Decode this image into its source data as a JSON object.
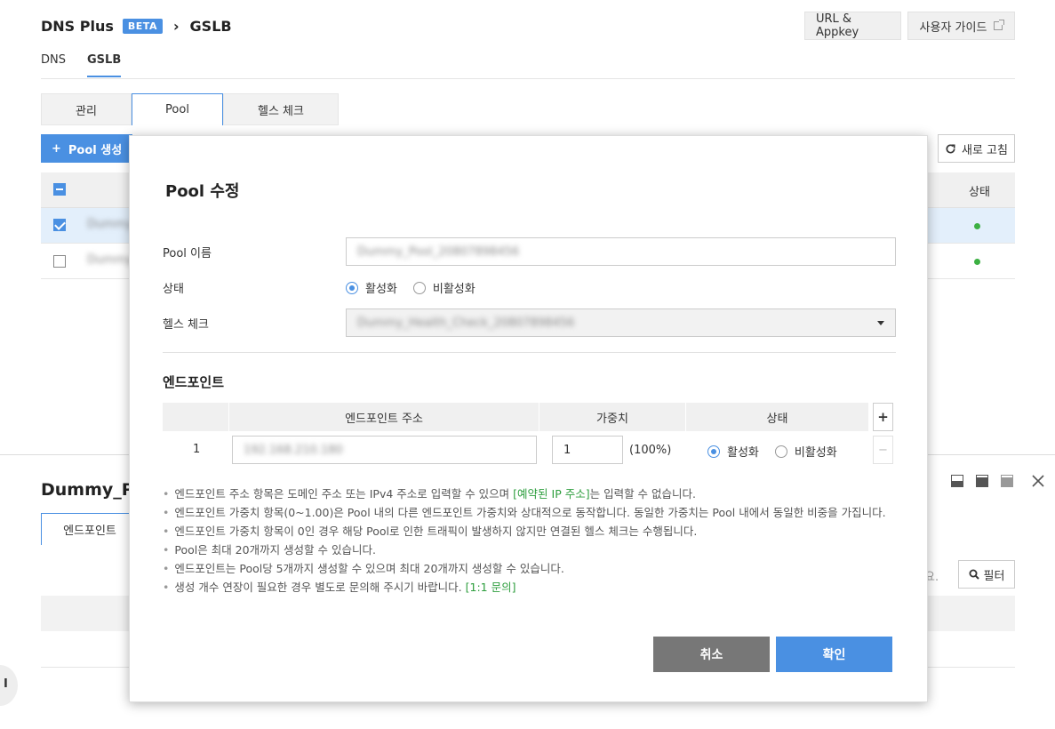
{
  "header": {
    "app_name": "DNS Plus",
    "beta_badge": "BETA",
    "crumb_sep": "›",
    "crumb_current": "GSLB",
    "url_appkey_label": "URL & Appkey",
    "user_guide_label": "사용자 가이드"
  },
  "service_tabs": [
    "DNS",
    "GSLB"
  ],
  "main_tabs": [
    "관리",
    "Pool",
    "헬스 체크"
  ],
  "toolbar": {
    "create_label": "Pool 생성",
    "create_plus": "+",
    "refresh_label": "새로 고침"
  },
  "grid": {
    "status_header": "상태",
    "rows": [
      {
        "name": "Dummy/",
        "checked": true
      },
      {
        "name": "Dummy/",
        "checked": false
      }
    ]
  },
  "detail": {
    "title": "Dummy_Po",
    "tab_endpoint": "엔드포인트",
    "filter_placeholder": "요.",
    "filter_label": "필터",
    "side_glyph": "I"
  },
  "modal": {
    "title": "Pool 수정",
    "pool_name_label": "Pool 이름",
    "pool_name_value": "Dummy_Pool_20807898456",
    "status_label": "상태",
    "status_active": "활성화",
    "status_inactive": "비활성화",
    "health_label": "헬스 체크",
    "health_value": "Dummy_Health_Check_20807898456",
    "endpoint_section": "엔드포인트",
    "ep_col_address": "엔드포인트 주소",
    "ep_col_weight": "가중치",
    "ep_col_status": "상태",
    "ep_plus": "+",
    "ep_minus": "−",
    "ep_row": {
      "index": "1",
      "address": "192.168.210.180",
      "weight": "1",
      "weight_pct": "(100%)",
      "active": "활성화",
      "inactive": "비활성화"
    },
    "notes": [
      {
        "pre": "엔드포인트 주소 항목은 도메인 주소 또는 IPv4 주소로 입력할 수 있으며 ",
        "link": "[예약된 IP 주소]",
        "post": "는 입력할 수 없습니다."
      },
      {
        "pre": "엔드포인트 가중치 항목(0~1.00)은 Pool 내의 다른 엔드포인트 가중치와 상대적으로 동작합니다. 동일한 가중치는 Pool 내에서 동일한 비중을 가집니다.",
        "link": "",
        "post": ""
      },
      {
        "pre": "엔드포인트 가중치 항목이 0인 경우 해당 Pool로 인한 트래픽이 발생하지 않지만 연결된 헬스 체크는 수행됩니다.",
        "link": "",
        "post": ""
      },
      {
        "pre": "Pool은 최대 20개까지 생성할 수 있습니다.",
        "link": "",
        "post": ""
      },
      {
        "pre": "엔드포인트는 Pool당 5개까지 생성할 수 있으며 최대 20개까지 생성할 수 있습니다.",
        "link": "",
        "post": ""
      },
      {
        "pre": "생성 개수 연장이 필요한 경우 별도로 문의해 주시기 바랍니다. ",
        "link": "[1:1 문의]",
        "post": ""
      }
    ],
    "note_bullet": "•",
    "cancel_label": "취소",
    "ok_label": "확인"
  },
  "colors": {
    "accent": "#4a90e2",
    "status_green": "#3cb043",
    "link_green": "#2e9e3e",
    "cancel_gray": "#777777"
  }
}
